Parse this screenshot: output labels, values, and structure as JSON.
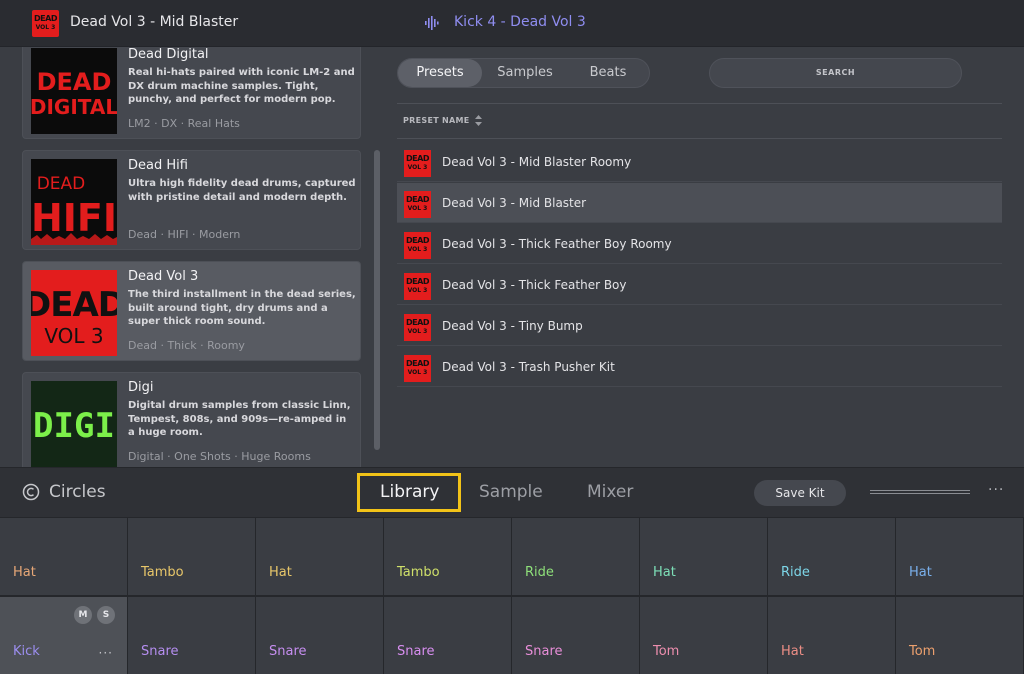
{
  "header": {
    "kit_thumb_line1": "DEAD",
    "kit_thumb_line2": "VOL 3",
    "kit_title": "Dead Vol 3 - Mid Blaster",
    "now_playing": "Kick 4 - Dead Vol 3",
    "now_playing_color": "#8f8df0"
  },
  "kits": [
    {
      "name": "Dead Digital",
      "art": [
        "DEAD",
        "DIGITAL"
      ],
      "desc": "Real hi-hats paired with iconic LM-2 and DX drum machine samples. Tight, punchy, and perfect for modern pop.",
      "tags": "LM2 · DX · Real Hats"
    },
    {
      "name": "Dead Hifi",
      "art": [
        "DEAD",
        "HIFI"
      ],
      "desc": "Ultra high fidelity dead drums, captured with pristine detail and modern depth.",
      "tags": "Dead · HIFI · Modern"
    },
    {
      "name": "Dead Vol 3",
      "art": [
        "DEAD",
        "VOL 3"
      ],
      "desc": "The third installment in the dead series, built around tight, dry drums and a super thick room sound.",
      "tags": "Dead · Thick · Roomy"
    },
    {
      "name": "Digi",
      "art": [
        "DIGI"
      ],
      "desc": "Digital drum samples from classic Linn, Tempest, 808s, and 909s—re-amped in a huge room.",
      "tags": "Digital · One Shots · Huge Rooms"
    }
  ],
  "browser": {
    "tabs": [
      "Presets",
      "Samples",
      "Beats"
    ],
    "search_placeholder": "SEARCH",
    "column_header": "PRESET NAME",
    "thumb_line1": "DEAD",
    "thumb_line2": "VOL 3",
    "presets": [
      "Dead Vol 3 - Mid Blaster Roomy",
      "Dead Vol 3 - Mid Blaster",
      "Dead Vol 3 - Thick Feather Boy Roomy",
      "Dead Vol 3 - Thick Feather Boy",
      "Dead Vol 3 - Tiny Bump",
      "Dead Vol 3 - Trash Pusher Kit"
    ]
  },
  "toolbar": {
    "brand": "Circles",
    "tabs": [
      "Library",
      "Sample",
      "Mixer"
    ],
    "save_label": "Save Kit",
    "more": "···"
  },
  "pads": {
    "top_row": [
      {
        "label": "Hat",
        "color": "#e8a877"
      },
      {
        "label": "Tambo",
        "color": "#e8c76a"
      },
      {
        "label": "Hat",
        "color": "#e8c76a"
      },
      {
        "label": "Tambo",
        "color": "#cfe06a"
      },
      {
        "label": "Ride",
        "color": "#8ee07a"
      },
      {
        "label": "Hat",
        "color": "#7de0b8"
      },
      {
        "label": "Ride",
        "color": "#7dd6e8"
      },
      {
        "label": "Hat",
        "color": "#7ab0ec"
      }
    ],
    "bottom_row": [
      {
        "label": "Kick",
        "color": "#9c8ef0"
      },
      {
        "label": "Snare",
        "color": "#b58ef0"
      },
      {
        "label": "Snare",
        "color": "#c68ef0"
      },
      {
        "label": "Snare",
        "color": "#d88ef0"
      },
      {
        "label": "Snare",
        "color": "#e88ed8"
      },
      {
        "label": "Tom",
        "color": "#ec8eae"
      },
      {
        "label": "Hat",
        "color": "#ec8e86"
      },
      {
        "label": "Tom",
        "color": "#eca06e"
      }
    ],
    "mute": "M",
    "solo": "S",
    "more": "···"
  }
}
